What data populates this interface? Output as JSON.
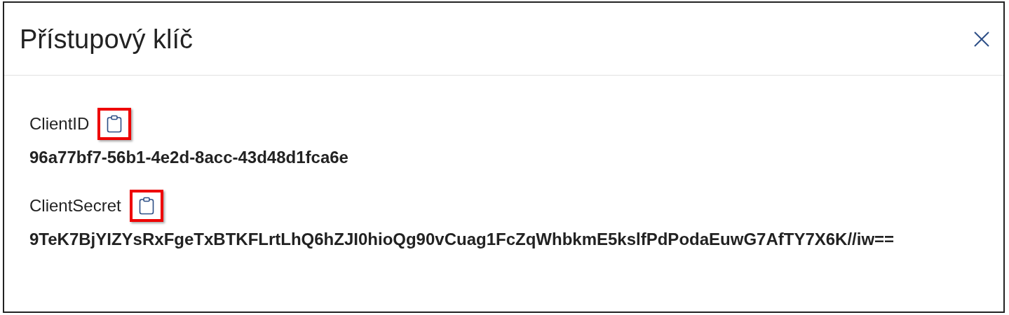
{
  "dialog": {
    "title": "Přístupový klíč"
  },
  "fields": [
    {
      "label": "ClientID",
      "value": "96a77bf7-56b1-4e2d-8acc-43d48d1fca6e",
      "highlighted": true
    },
    {
      "label": "ClientSecret",
      "value": "9TeK7BjYIZYsRxFgeTxBTKFLrtLhQ6hZJI0hioQg90vCuag1FcZqWhbkmE5kslfPdPodaEuwG7AfTY7X6K//iw==",
      "highlighted": true
    }
  ]
}
